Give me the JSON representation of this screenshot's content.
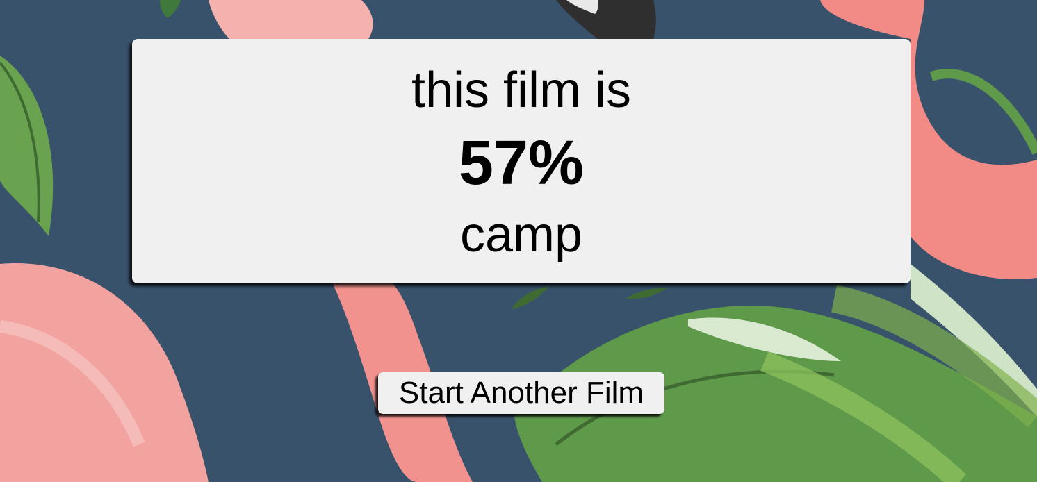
{
  "result": {
    "intro_text": "this film is",
    "percent_text": "57%",
    "percent_value": 57,
    "label_text": "camp"
  },
  "actions": {
    "restart_label": "Start Another Film"
  },
  "background": {
    "description_colors": {
      "base": "#39526b",
      "flamingo": "#f29b98",
      "leaf": "#5e9a4a"
    }
  }
}
